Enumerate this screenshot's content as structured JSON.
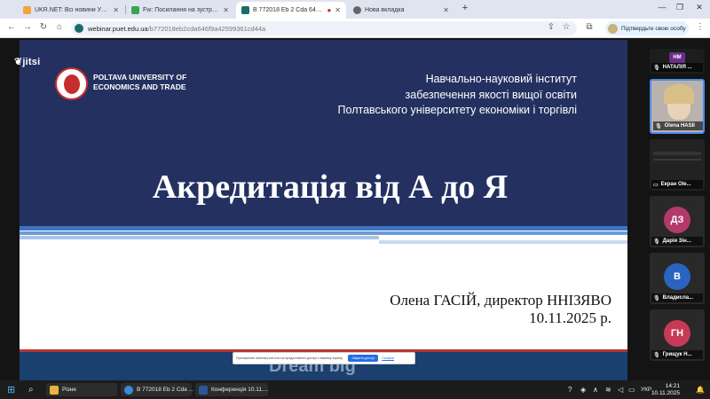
{
  "browser": {
    "tabs": [
      {
        "title": "UKR.NET: Всі новини України, ...",
        "favicon_color": "#f0a43a"
      },
      {
        "title": "Fw: Посилання на зустріч \"Акр...",
        "favicon_color": "#3aa34f"
      },
      {
        "title": "В 772018 Eb 2 Cda 646 F9...",
        "favicon_color": "#1a6b6b",
        "active": true
      },
      {
        "title": "Нова вкладка",
        "favicon_color": "#666666"
      }
    ],
    "new_tab_glyph": "+",
    "url_host": "webinar.puet.edu.ua",
    "url_path": "/b772018eb2cda646f9a42599361cd44a",
    "profile_label": "Підтвердьте свою особу"
  },
  "meeting": {
    "app_logo": "jitsi",
    "slide": {
      "university_name_line1": "POLTAVA UNIVERSITY OF",
      "university_name_line2": "ECONOMICS AND TRADE",
      "institute_line1": "Навчально-науковий інститут",
      "institute_line2": "забезпечення якості вищої освіти",
      "institute_line3": "Полтавського університету економіки і торгівлі",
      "title": "Акредитація від А до Я",
      "author": "Олена ГАСІЙ, директор ННІЗЯВО",
      "date": "10.11.2025 р.",
      "footer_text": "Dream big"
    },
    "cookie_banner": {
      "text": "Приложение webinar.puet.edu.ua предоставлен доступ к вашему экрану.",
      "accept_label": "Закрити доступ",
      "more_label": "Сховати"
    },
    "participants": [
      {
        "initials": "НМ",
        "name": "НАТАЛІЯ ...",
        "color": "#6b2e8c"
      },
      {
        "initials": "",
        "name": "Olena HASII",
        "color": "#7a6a5a"
      },
      {
        "initials": "",
        "name": "Екран Ole...",
        "color": "#2a2a2a"
      },
      {
        "initials": "ДЗ",
        "name": "Дарія Зін...",
        "color": "#b23a6a"
      },
      {
        "initials": "В",
        "name": "Владисла...",
        "color": "#2a64c0"
      },
      {
        "initials": "ГН",
        "name": "Грищук Н...",
        "color": "#c73a55"
      }
    ]
  },
  "taskbar": {
    "items": [
      {
        "label": "Різне",
        "color": "#e8b53c"
      },
      {
        "label": "В 772018 Eb 2 Cda ...",
        "color": "#3a8ad8"
      },
      {
        "label": "Конференція 10.11....",
        "color": "#2b579a"
      }
    ],
    "lang": "УКР",
    "time": "14:21",
    "date": "10.11.2025"
  }
}
